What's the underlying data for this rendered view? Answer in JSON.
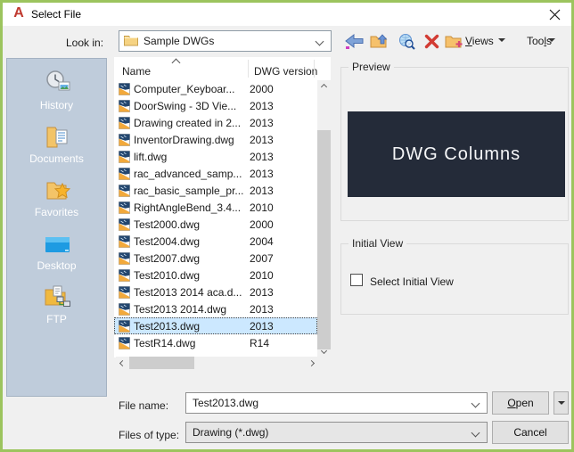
{
  "window": {
    "title": "Select File",
    "logo_glyph": "A",
    "close_icon": "x"
  },
  "colors": {
    "dialog_border_green": "#9cc45e",
    "sidebar_bg": "#bfccdb",
    "selection_bg": "#cce8ff",
    "preview_image_bg": "#242b39",
    "autocad_logo_red": "#c0392f"
  },
  "toolbar": {
    "look_in_label": "Look in:",
    "look_in_value": "Sample DWGs",
    "icon_names": [
      "back-icon",
      "up-one-level-icon",
      "search-web-icon",
      "delete-icon",
      "new-folder-icon"
    ],
    "views_label": {
      "pre": "",
      "accel": "V",
      "post": "iews"
    },
    "tools_label": {
      "pre": "Too",
      "accel": "l",
      "post": "s"
    }
  },
  "sidebar": {
    "items": [
      {
        "label": "History",
        "icon": "history-icon"
      },
      {
        "label": "Documents",
        "icon": "documents-icon"
      },
      {
        "label": "Favorites",
        "icon": "favorites-icon"
      },
      {
        "label": "Desktop",
        "icon": "desktop-icon"
      },
      {
        "label": "FTP",
        "icon": "ftp-icon"
      }
    ]
  },
  "file_list": {
    "columns": {
      "name": "Name",
      "version": "DWG version"
    },
    "sort": {
      "column": "Name",
      "direction": "ascending"
    },
    "rows": [
      {
        "name": "Computer_Keyboar...",
        "version": "2000"
      },
      {
        "name": "DoorSwing - 3D Vie...",
        "version": "2013"
      },
      {
        "name": "Drawing created in 2...",
        "version": "2013"
      },
      {
        "name": "InventorDrawing.dwg",
        "version": "2013"
      },
      {
        "name": "lift.dwg",
        "version": "2013"
      },
      {
        "name": "rac_advanced_samp...",
        "version": "2013"
      },
      {
        "name": "rac_basic_sample_pr...",
        "version": "2013"
      },
      {
        "name": "RightAngleBend_3.4...",
        "version": "2010"
      },
      {
        "name": "Test2000.dwg",
        "version": "2000"
      },
      {
        "name": "Test2004.dwg",
        "version": "2004"
      },
      {
        "name": "Test2007.dwg",
        "version": "2007"
      },
      {
        "name": "Test2010.dwg",
        "version": "2010"
      },
      {
        "name": "Test2013 2014 aca.d...",
        "version": "2013"
      },
      {
        "name": "Test2013 2014.dwg",
        "version": "2013"
      },
      {
        "name": "Test2013.dwg",
        "version": "2013",
        "selected": true
      },
      {
        "name": "TestR14.dwg",
        "version": "R14"
      }
    ]
  },
  "preview": {
    "label": "Preview",
    "image_text": "DWG Columns"
  },
  "initial_view": {
    "label": "Initial View",
    "checkbox_label": "Select Initial View",
    "checked": false
  },
  "footer": {
    "file_name_label": "File name:",
    "file_name_value": "Test2013.dwg",
    "files_of_type_label": "Files of type:",
    "files_of_type_value": "Drawing (*.dwg)",
    "open_label": {
      "accel": "O",
      "post": "pen"
    },
    "cancel_label": "Cancel"
  }
}
